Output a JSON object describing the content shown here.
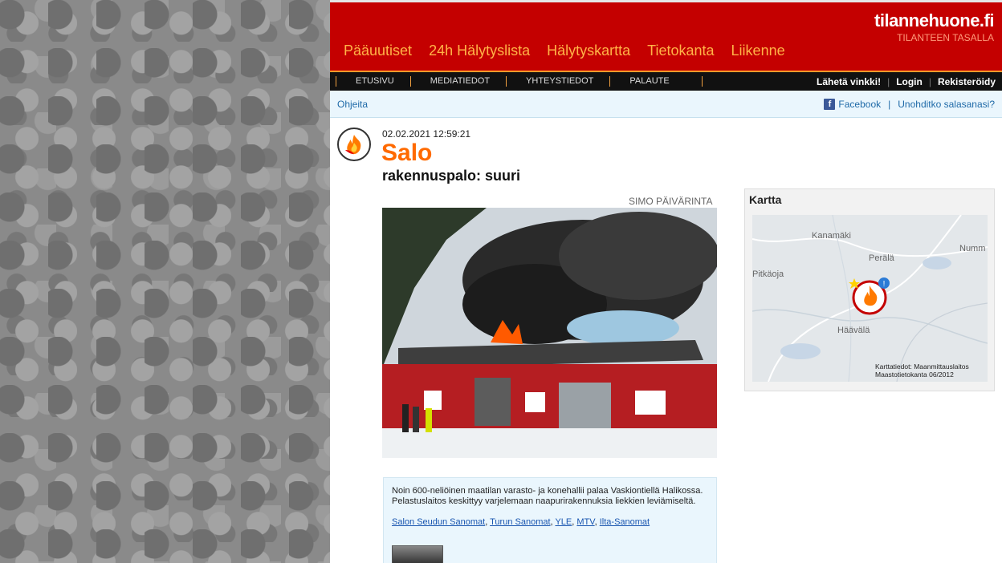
{
  "brand": {
    "name": "tilannehuone.fi",
    "tagline": "TILANTEEN TASALLA"
  },
  "main_nav": [
    "Pääuutiset",
    "24h Hälytyslista",
    "Hälytyskartta",
    "Tietokanta",
    "Liikenne"
  ],
  "sub_nav": [
    "ETUSIVU",
    "MEDIATIEDOT",
    "YHTEYSTIEDOT",
    "PALAUTE"
  ],
  "sub_right": {
    "tip": "Lähetä vinkki!",
    "login": "Login",
    "register": "Rekisteröidy"
  },
  "infobar": {
    "help": "Ohjeita",
    "facebook": "Facebook",
    "forgot": "Unohditko salasanasi?"
  },
  "article": {
    "timestamp": "02.02.2021 12:59:21",
    "city": "Salo",
    "event": "rakennuspalo: suuri",
    "photo_credit": "SIMO PÄIVÄRINTA",
    "summary": "Noin 600-neliöinen maatilan varasto- ja konehallii palaa Vaskiontiellä Halikossa. Pelastuslaitos keskittyy varjelemaan naapurirakennuksia liekkien leviämiseltä.",
    "sources": [
      "Salon Seudun Sanomat",
      "Turun Sanomat",
      "YLE",
      "MTV",
      "Ilta-Sanomat"
    ]
  },
  "map": {
    "title": "Kartta",
    "places": [
      "Kanamäki",
      "Perälä",
      "Numm",
      "Pitkäoja",
      "Häävälä"
    ],
    "credit_line1": "Karttatiedot: Maanmittauslaitos",
    "credit_line2": "Maastotietokanta 06/2012"
  },
  "colors": {
    "header_red": "#c40000",
    "nav_orange": "#ffb347",
    "city_orange": "#ff6a00"
  }
}
